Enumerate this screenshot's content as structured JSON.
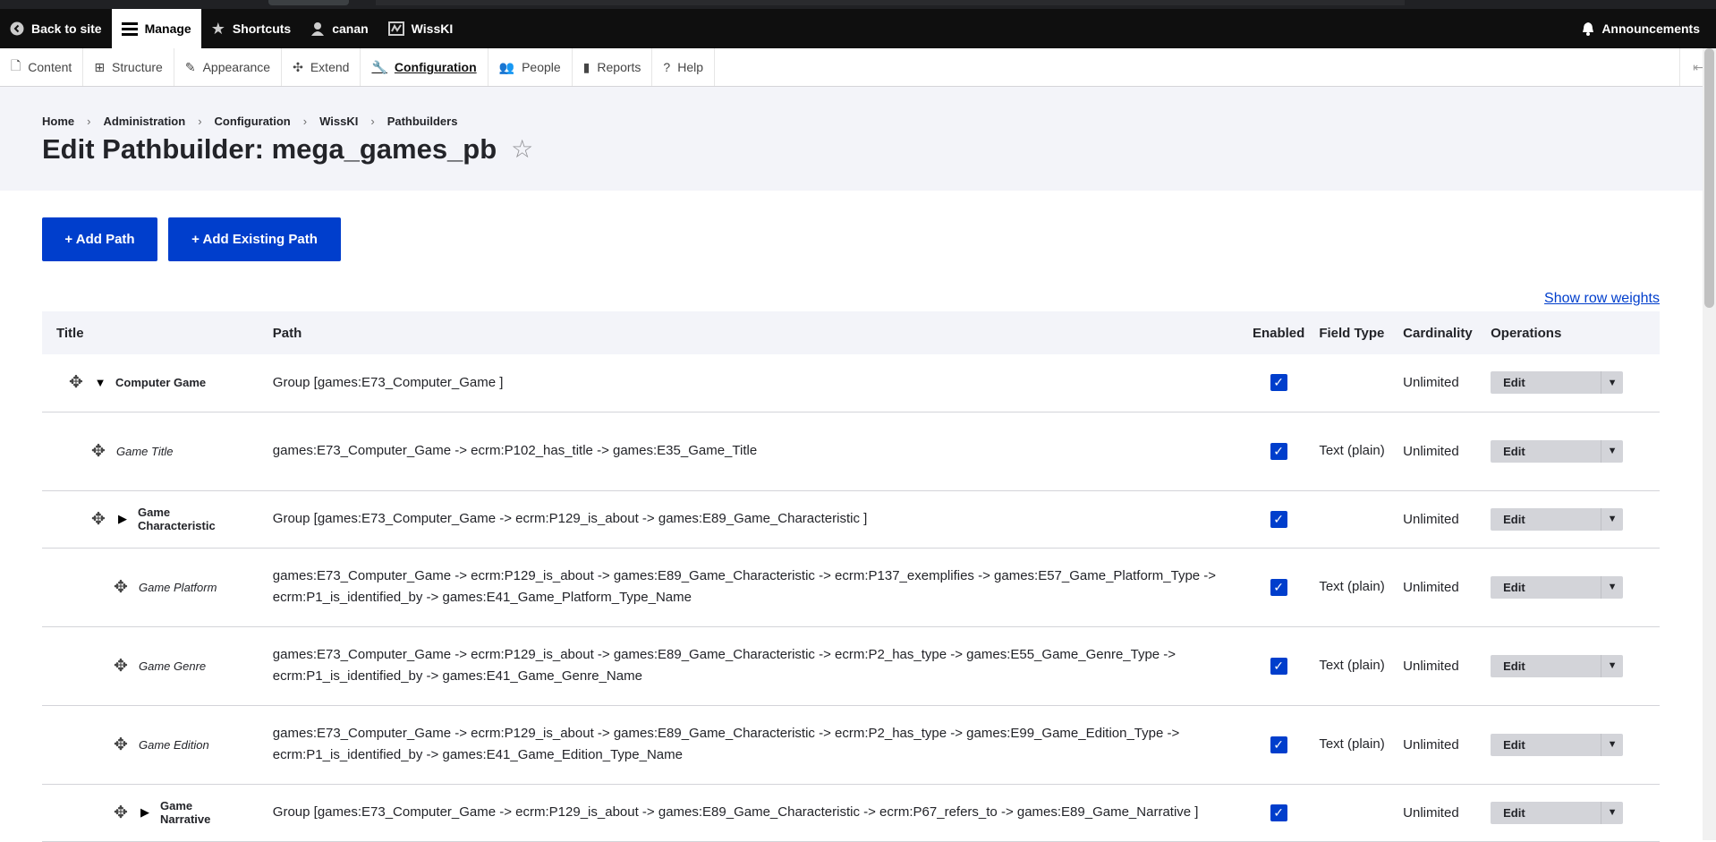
{
  "toolbar": {
    "back": "Back to site",
    "manage": "Manage",
    "shortcuts": "Shortcuts",
    "user": "canan",
    "wisski": "WissKI",
    "announcements": "Announcements"
  },
  "tray": [
    {
      "label": "Content",
      "icon": "file-icon"
    },
    {
      "label": "Structure",
      "icon": "sitemap-icon"
    },
    {
      "label": "Appearance",
      "icon": "brush-icon"
    },
    {
      "label": "Extend",
      "icon": "puzzle-icon"
    },
    {
      "label": "Configuration",
      "icon": "wrench-icon"
    },
    {
      "label": "People",
      "icon": "people-icon"
    },
    {
      "label": "Reports",
      "icon": "bar-chart-icon"
    },
    {
      "label": "Help",
      "icon": "help-icon"
    }
  ],
  "breadcrumb": [
    "Home",
    "Administration",
    "Configuration",
    "WissKI",
    "Pathbuilders"
  ],
  "page_title": "Edit Pathbuilder: mega_games_pb",
  "buttons": {
    "add_path": "+ Add Path",
    "add_existing": "+ Add Existing Path"
  },
  "show_row_weights": "Show row weights",
  "table": {
    "headers": {
      "title": "Title",
      "path": "Path",
      "enabled": "Enabled",
      "field_type": "Field Type",
      "cardinality": "Cardinality",
      "operations": "Operations"
    },
    "rows": [
      {
        "title": "Computer Game",
        "path": "Group [games:E73_Computer_Game ]",
        "field_type": "",
        "cardinality": "Unlimited",
        "edit": "Edit"
      },
      {
        "title": "Game Title",
        "path": "games:E73_Computer_Game -> ecrm:P102_has_title -> games:E35_Game_Title",
        "field_type": "Text (plain)",
        "cardinality": "Unlimited",
        "edit": "Edit"
      },
      {
        "title": "Game Characteristic",
        "path": "Group [games:E73_Computer_Game -> ecrm:P129_is_about -> games:E89_Game_Characteristic ]",
        "field_type": "",
        "cardinality": "Unlimited",
        "edit": "Edit"
      },
      {
        "title": "Game Platform",
        "path": "games:E73_Computer_Game -> ecrm:P129_is_about -> games:E89_Game_Characteristic -> ecrm:P137_exemplifies -> games:E57_Game_Platform_Type -> ecrm:P1_is_identified_by -> games:E41_Game_Platform_Type_Name",
        "field_type": "Text (plain)",
        "cardinality": "Unlimited",
        "edit": "Edit"
      },
      {
        "title": "Game Genre",
        "path": "games:E73_Computer_Game -> ecrm:P129_is_about -> games:E89_Game_Characteristic -> ecrm:P2_has_type -> games:E55_Game_Genre_Type -> ecrm:P1_is_identified_by -> games:E41_Game_Genre_Name",
        "field_type": "Text (plain)",
        "cardinality": "Unlimited",
        "edit": "Edit"
      },
      {
        "title": "Game Edition",
        "path": "games:E73_Computer_Game -> ecrm:P129_is_about -> games:E89_Game_Characteristic -> ecrm:P2_has_type -> games:E99_Game_Edition_Type -> ecrm:P1_is_identified_by -> games:E41_Game_Edition_Type_Name",
        "field_type": "Text (plain)",
        "cardinality": "Unlimited",
        "edit": "Edit"
      },
      {
        "title": "Game Narrative",
        "path": "Group [games:E73_Computer_Game -> ecrm:P129_is_about -> games:E89_Game_Characteristic -> ecrm:P67_refers_to -> games:E89_Game_Narrative ]",
        "field_type": "",
        "cardinality": "Unlimited",
        "edit": "Edit"
      }
    ]
  },
  "colors": {
    "toolbar_bg": "#0f0f0f",
    "primary": "#003ecc",
    "header_bg": "#f3f4f9"
  }
}
